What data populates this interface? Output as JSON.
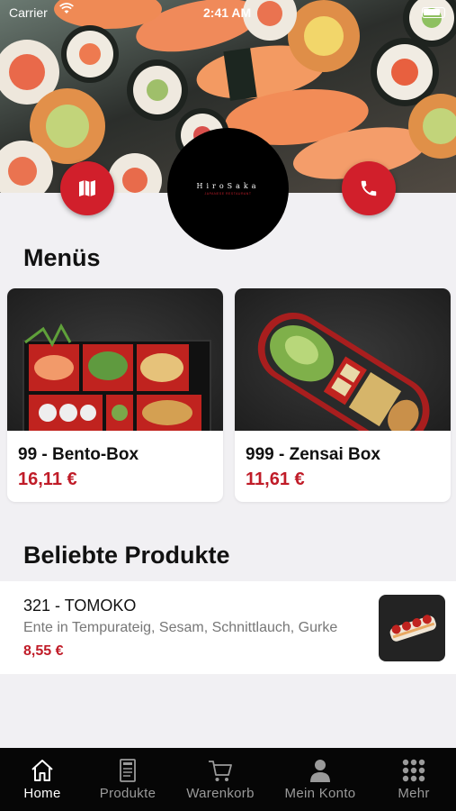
{
  "status_bar": {
    "carrier": "Carrier",
    "time": "2:41 AM"
  },
  "header": {
    "logo_title": "HiroSaka",
    "logo_subtitle": "JAPANESE RESTAURANT",
    "map_icon": "map-icon",
    "phone_icon": "phone-icon"
  },
  "menus": {
    "title": "Menüs",
    "items": [
      {
        "name": "99 - Bento-Box",
        "price": "16,11 €"
      },
      {
        "name": "999 - Zensai Box",
        "price": "11,61 €"
      }
    ]
  },
  "popular": {
    "title": "Beliebte Produkte",
    "items": [
      {
        "name": "321 - TOMOKO",
        "description": "Ente in Tempurateig, Sesam, Schnittlauch, Gurke",
        "price": "8,55 €"
      }
    ]
  },
  "tabs": [
    {
      "label": "Home",
      "icon": "home-icon",
      "active": true
    },
    {
      "label": "Produkte",
      "icon": "menu-card-icon",
      "active": false
    },
    {
      "label": "Warenkorb",
      "icon": "cart-icon",
      "active": false
    },
    {
      "label": "Mein Konto",
      "icon": "user-icon",
      "active": false
    },
    {
      "label": "Mehr",
      "icon": "grid-icon",
      "active": false
    }
  ],
  "colors": {
    "accent": "#d11f2b",
    "price": "#c01c28",
    "tab_bar": "#060606",
    "background": "#f1f0f3"
  }
}
